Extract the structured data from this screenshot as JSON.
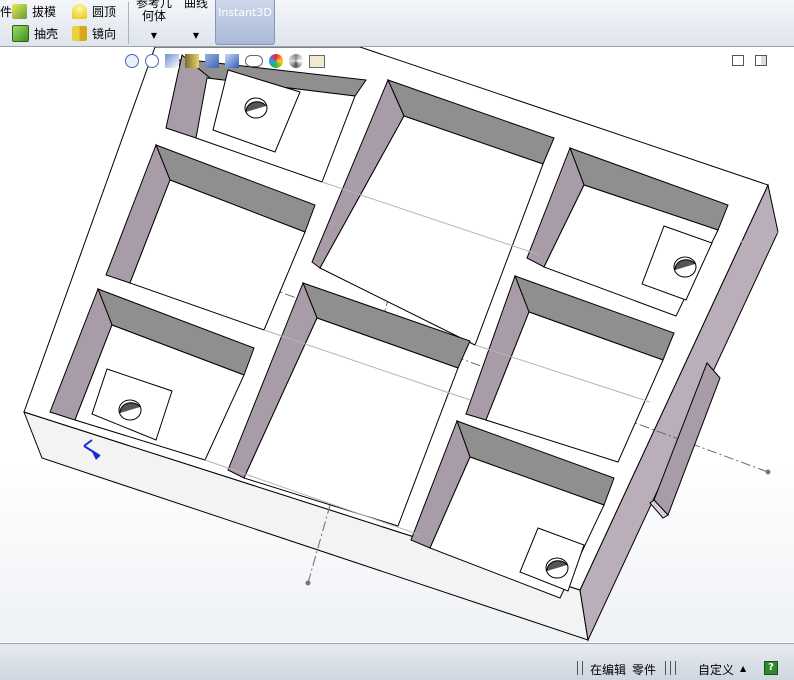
{
  "ribbon": {
    "cut_label": "件",
    "draft_label": "拔模",
    "dome_label": "圆顶",
    "shell_label": "抽壳",
    "mirror_label": "镜向",
    "ref_geometry_line1": "参考几",
    "ref_geometry_line2": "何体",
    "curves_label": "曲线",
    "instant3d_label": "Instant3D"
  },
  "heads_up_toolbar": {
    "icons": [
      "zoom-to-fit-icon",
      "zoom-to-area-icon",
      "previous-view-icon",
      "section-view-icon",
      "view-orientation-icon",
      "display-style-icon",
      "hide-show-items-icon",
      "edit-appearance-icon",
      "apply-scene-icon",
      "view-settings-icon"
    ]
  },
  "viewport_corner_icons": [
    "tile-viewport-icon",
    "split-viewport-icon"
  ],
  "status": {
    "editing_label": "在编辑",
    "part_label": "零件",
    "custom_label": "自定义",
    "help_label": "?"
  },
  "colors": {
    "face_white": "#ffffff",
    "wall_shade": "#a99ca9",
    "inner_shade": "#8f8f8f",
    "edge": "#000000",
    "bottom_face": "#f2f2f2"
  }
}
